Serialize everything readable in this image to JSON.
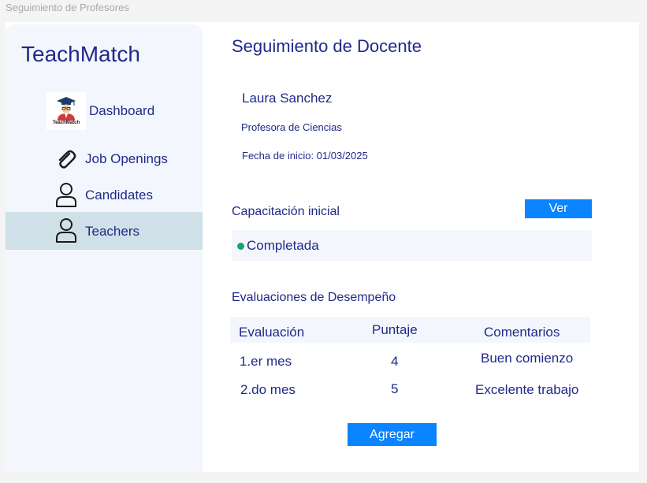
{
  "window": {
    "title": "Seguimiento de Profesores"
  },
  "sidebar": {
    "brand": "TeachMatch",
    "logo_text": "TeachMatch",
    "items": [
      {
        "label": "Dashboard",
        "icon": "teachmatch-logo-icon"
      },
      {
        "label": "Job Openings",
        "icon": "paperclip-icon"
      },
      {
        "label": "Candidates",
        "icon": "person-icon"
      },
      {
        "label": "Teachers",
        "icon": "person-icon",
        "active": true
      }
    ]
  },
  "main": {
    "title": "Seguimiento de Docente",
    "teacher": {
      "name": "Laura Sanchez",
      "role": "Profesora de Ciencias",
      "start_date": "Fecha de inicio: 01/03/2025"
    },
    "training": {
      "label": "Capacitación inicial",
      "view_button": "Ver",
      "status": "Completada",
      "status_color": "#1aa372"
    },
    "evaluations": {
      "title": "Evaluaciones de Desempeño",
      "columns": [
        "Evaluación",
        "Puntaje",
        "Comentarios"
      ],
      "rows": [
        {
          "evaluation": "1.er mes",
          "score": "4",
          "comment": "Buen comienzo"
        },
        {
          "evaluation": "2.do mes",
          "score": "5",
          "comment": "Excelente trabajo"
        }
      ]
    },
    "add_button": "Agregar"
  },
  "colors": {
    "accent": "#0a84ff",
    "text": "#1f2a8a",
    "sidebar_bg": "#f3f7fd",
    "active_bg": "#cfe0e8"
  }
}
